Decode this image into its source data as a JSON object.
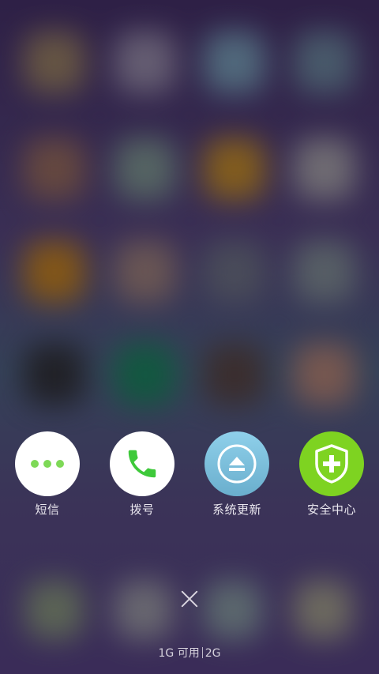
{
  "background": {
    "blurred_icon_colors": [
      [
        "#6b5a43",
        "#6a6376",
        "#547081",
        "#4b5f6e"
      ],
      [
        "#6a4b3e",
        "#586a65",
        "#8a6219",
        "#757276"
      ],
      [
        "#8a5a12",
        "#6e5954",
        "#4b4e5a",
        "#5a6367"
      ],
      [
        "#1f1e22",
        "#0f5a3e",
        "#3b2c2a",
        "#7e5a4f"
      ]
    ],
    "blurred_bottom_colors": [
      "#5f6a55",
      "#6d6d72",
      "#5f6e70",
      "#727060"
    ]
  },
  "dock": [
    {
      "name": "sms",
      "label": "短信",
      "bg": "#ffffff",
      "icon": "ellipsis-icon",
      "icon_color": "#7ed957"
    },
    {
      "name": "dialer",
      "label": "拨号",
      "bg": "#ffffff",
      "icon": "phone-icon",
      "icon_color": "#3ec93a"
    },
    {
      "name": "system-update",
      "label": "系统更新",
      "bg": "#79bedc",
      "icon": "eject-icon",
      "icon_color": "#ffffff"
    },
    {
      "name": "security-center",
      "label": "安全中心",
      "bg": "#7ed321",
      "icon": "shield-plus-icon",
      "icon_color": "#ffffff"
    }
  ],
  "memory": {
    "available": "1G 可用",
    "total": "2G"
  }
}
